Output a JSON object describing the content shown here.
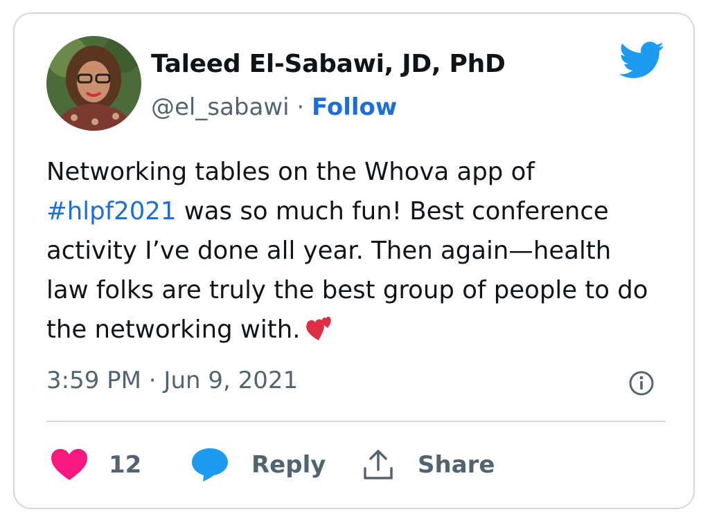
{
  "author": {
    "display_name": "Taleed El-Sabawi, JD, PhD",
    "handle": "@el_sabawi",
    "separator": "·",
    "follow_label": "Follow"
  },
  "tweet": {
    "text_before": "Networking tables on the Whova app of ",
    "hashtag": "#hlpf2021",
    "text_after": " was so much fun! Best conference activity I’ve done all year. Then again—health law folks are truly the best group of people to do the networking with.",
    "emoji": "two-hearts",
    "timestamp": "3:59 PM · Jun 9, 2021"
  },
  "actions": {
    "like_count": "12",
    "reply_label": "Reply",
    "share_label": "Share"
  },
  "icons": {
    "brand": "twitter-bird-icon",
    "info": "info-icon",
    "like": "heart-icon",
    "reply": "speech-bubble-icon",
    "share": "share-upload-icon"
  },
  "colors": {
    "twitter_blue": "#1d9bf0",
    "link_blue": "#1d6fd6",
    "like_pink": "#f91880",
    "secondary_text": "#536471",
    "border": "#cfd9de",
    "emoji_red": "#dd2e44"
  }
}
